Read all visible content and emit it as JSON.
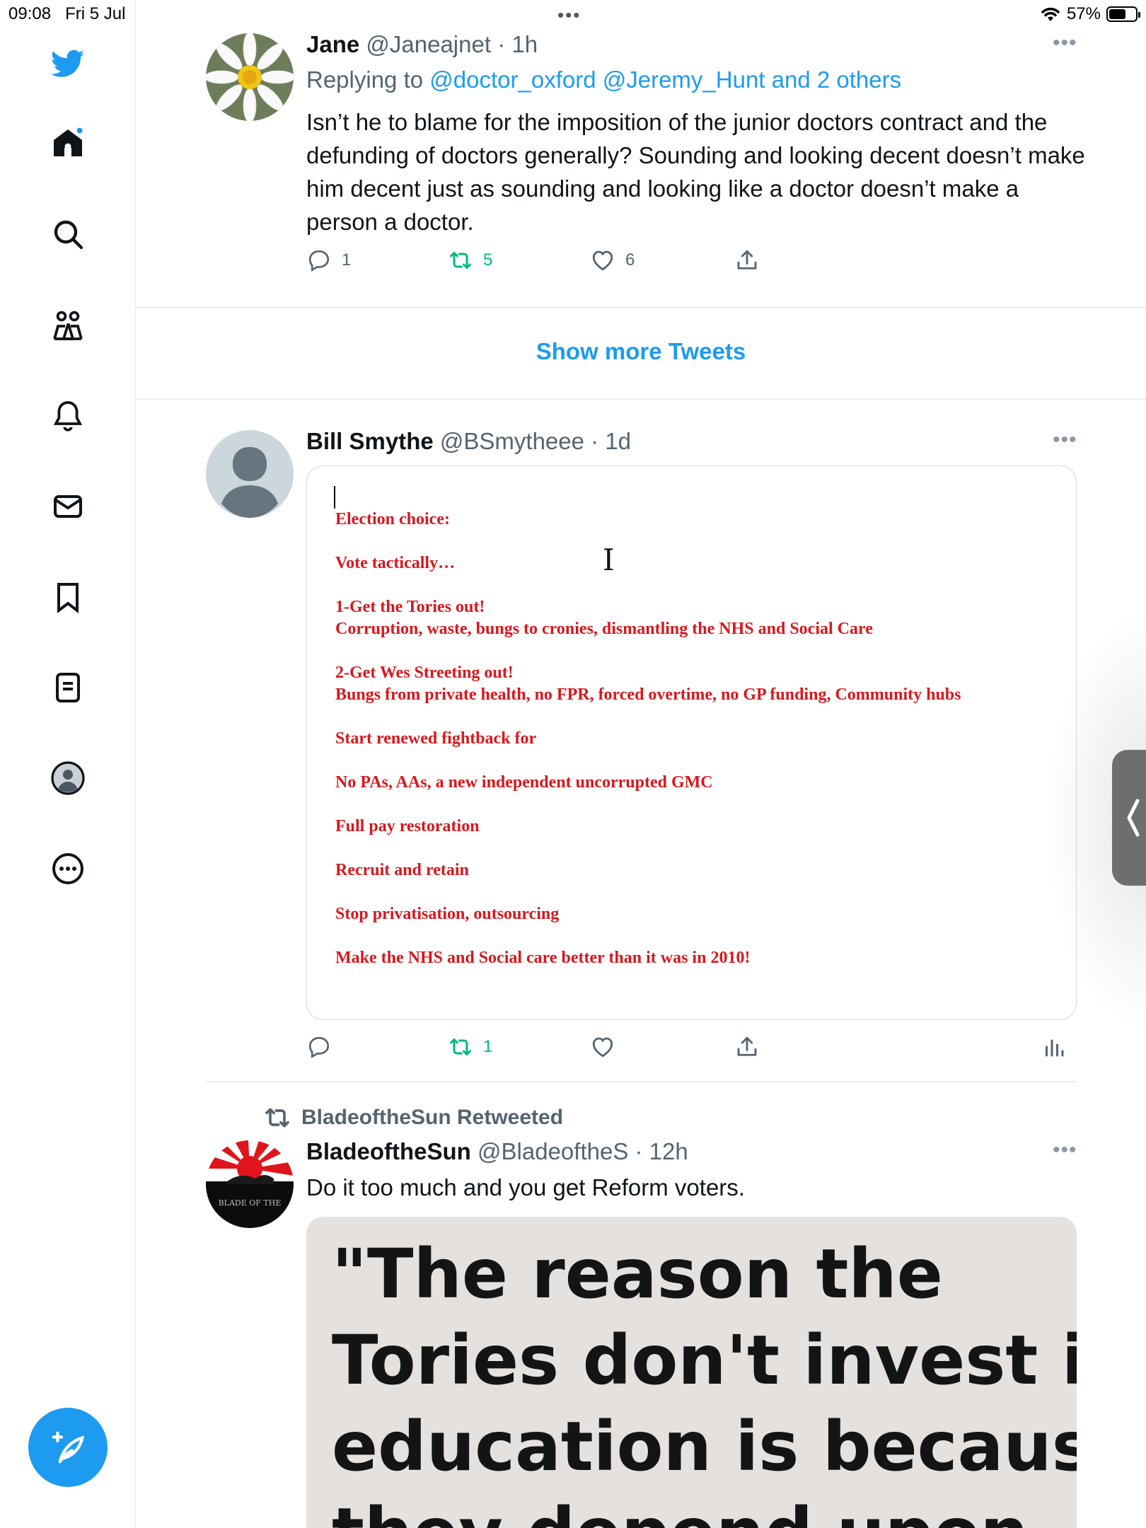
{
  "status_bar": {
    "time": "09:08",
    "date": "Fri 5 Jul",
    "battery": "57%"
  },
  "sidebar": {
    "items": [
      {
        "name": "twitter-logo-icon"
      },
      {
        "name": "home-icon"
      },
      {
        "name": "search-icon"
      },
      {
        "name": "communities-icon"
      },
      {
        "name": "notifications-icon"
      },
      {
        "name": "messages-icon"
      },
      {
        "name": "bookmarks-icon"
      },
      {
        "name": "lists-icon"
      },
      {
        "name": "profile-icon"
      },
      {
        "name": "more-icon"
      }
    ],
    "compose_icon": "compose-tweet-icon"
  },
  "tweets": [
    {
      "name": "Jane",
      "handle": "@Janeajnet",
      "time": "· 1h",
      "replying_prefix": "Replying to",
      "replying_to": "@doctor_oxford @Jeremy_Hunt and 2 others",
      "text": "Isn’t he to blame for the imposition of the junior doctors contract and the defunding of doctors generally?  Sounding and looking decent doesn’t make him decent just as sounding and looking like a doctor doesn’t make a person a doctor.",
      "replies": "1",
      "retweets": "5",
      "likes": "6"
    },
    {
      "name": "Bill Smythe",
      "handle": "@BSmytheee",
      "time": "· 1d",
      "replies": "",
      "retweets": "1",
      "likes": "",
      "card_lines": [
        "Election choice:",
        "",
        "Vote tactically…",
        "",
        "1-Get the Tories out!",
        "Corruption, waste, bungs to cronies, dismantling the NHS and Social Care",
        "",
        "2-Get Wes Streeting out!",
        "Bungs from private health, no FPR, forced overtime, no GP funding, Community hubs",
        "",
        "Start renewed fightback for",
        "",
        "No PAs, AAs, a new independent uncorrupted GMC",
        "",
        "Full pay restoration",
        "",
        "Recruit and retain",
        "",
        "Stop privatisation, outsourcing",
        "",
        "Make the NHS and Social care better than it was in 2010!"
      ]
    },
    {
      "retweeted_by": "BladeoftheSun Retweeted",
      "name": "BladeoftheSun",
      "handle": "@BladeoftheS",
      "time": "· 12h",
      "text": "Do it too much and you get Reform voters.",
      "avatar_text": "BLADE OF THE",
      "image_lines": [
        "\"The reason the",
        "Tories don't invest in",
        "education is because",
        "they  depend upon"
      ]
    }
  ],
  "show_more": "Show more Tweets",
  "colors": {
    "accent": "#1d9bf0",
    "retweet": "#00ba7c",
    "card_text": "#d6181e"
  }
}
